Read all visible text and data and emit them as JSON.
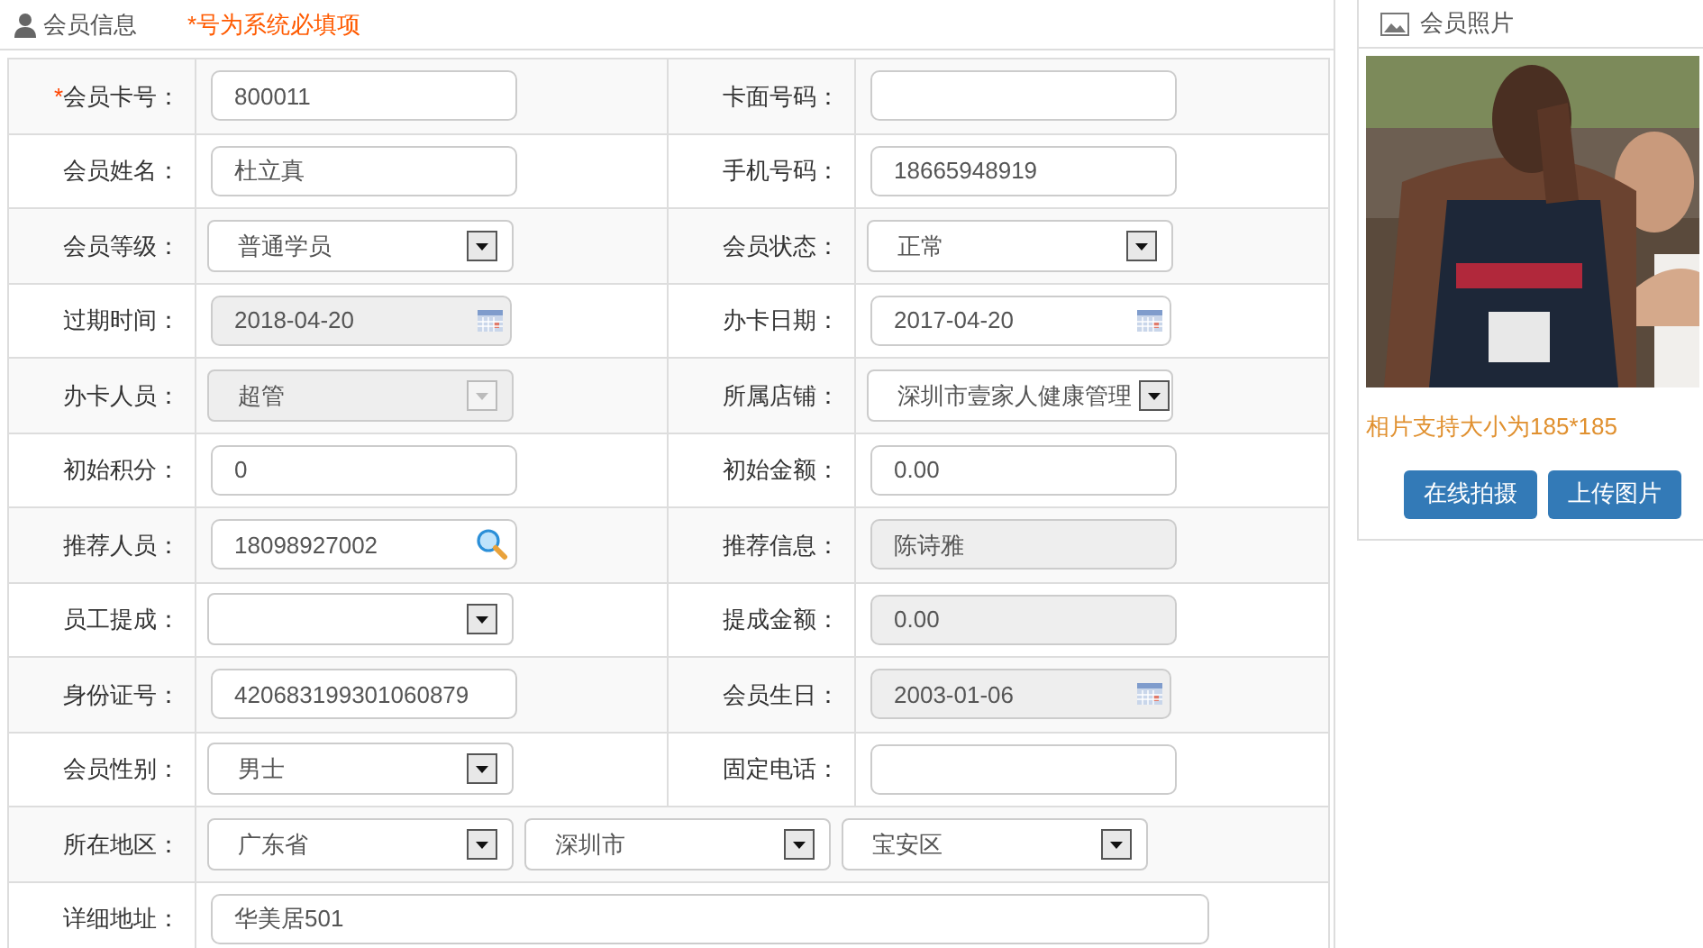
{
  "form_header": {
    "title": "会员信息",
    "note": "*号为系统必填项"
  },
  "rows": [
    {
      "cells": [
        {
          "label": "会员卡号：",
          "required_mark": "*",
          "field": {
            "kind": "text",
            "value": "800011",
            "disabled": false
          }
        },
        {
          "label": "卡面号码：",
          "field": {
            "kind": "text",
            "disabled": false
          }
        }
      ]
    },
    {
      "cells": [
        {
          "label": "会员姓名：",
          "field": {
            "kind": "text",
            "value": "杜立真",
            "disabled": false
          }
        },
        {
          "label": "手机号码：",
          "field": {
            "kind": "text",
            "value": "18665948919",
            "disabled": false
          }
        }
      ]
    },
    {
      "cells": [
        {
          "label": "会员等级：",
          "field": {
            "kind": "select",
            "value": "普通学员",
            "disabled": false
          }
        },
        {
          "label": "会员状态：",
          "field": {
            "kind": "select",
            "value": "正常",
            "disabled": false
          }
        }
      ]
    },
    {
      "cells": [
        {
          "label": "过期时间：",
          "field": {
            "kind": "date",
            "value": "2018-04-20",
            "disabled": true
          }
        },
        {
          "label": "办卡日期：",
          "field": {
            "kind": "date",
            "value": "2017-04-20",
            "disabled": false
          }
        }
      ]
    },
    {
      "cells": [
        {
          "label": "办卡人员：",
          "field": {
            "kind": "select",
            "value": "超管",
            "disabled": true
          }
        },
        {
          "label": "所属店铺：",
          "field": {
            "kind": "select",
            "value": "深圳市壹家人健康管理",
            "disabled": false
          }
        }
      ]
    },
    {
      "cells": [
        {
          "label": "初始积分：",
          "field": {
            "kind": "text",
            "value": "0",
            "disabled": false
          }
        },
        {
          "label": "初始金额：",
          "field": {
            "kind": "text",
            "value": "0.00",
            "disabled": false
          }
        }
      ]
    },
    {
      "cells": [
        {
          "label": "推荐人员：",
          "field": {
            "kind": "search",
            "value": "18098927002",
            "disabled": false
          }
        },
        {
          "label": "推荐信息：",
          "field": {
            "kind": "text",
            "value": "陈诗雅",
            "disabled": true
          }
        }
      ]
    },
    {
      "cells": [
        {
          "label": "员工提成：",
          "field": {
            "kind": "select",
            "disabled": false
          }
        },
        {
          "label": "提成金额：",
          "field": {
            "kind": "text",
            "value": "0.00",
            "disabled": true
          }
        }
      ]
    },
    {
      "cells": [
        {
          "label": "身份证号：",
          "field": {
            "kind": "text",
            "value": "420683199301060879",
            "disabled": false
          }
        },
        {
          "label": "会员生日：",
          "field": {
            "kind": "date",
            "value": "2003-01-06",
            "disabled": true
          }
        }
      ]
    },
    {
      "cells": [
        {
          "label": "会员性别：",
          "field": {
            "kind": "select",
            "value": "男士",
            "disabled": false
          }
        },
        {
          "label": "固定电话：",
          "field": {
            "kind": "text",
            "disabled": false
          }
        }
      ]
    },
    {
      "kind": "region",
      "label": "所在地区：",
      "selects": [
        {
          "value": "广东省"
        },
        {
          "value": "深圳市"
        },
        {
          "value": "宝安区"
        }
      ]
    },
    {
      "kind": "wide",
      "label": "详细地址：",
      "field": {
        "kind": "text",
        "value": "华美居501",
        "disabled": false
      }
    }
  ],
  "photo_panel": {
    "title": "会员照片",
    "photo": {
      "kind": "picture"
    },
    "hint": "相片支持大小为185*185",
    "buttons": [
      "在线拍摄",
      "上传图片"
    ]
  }
}
